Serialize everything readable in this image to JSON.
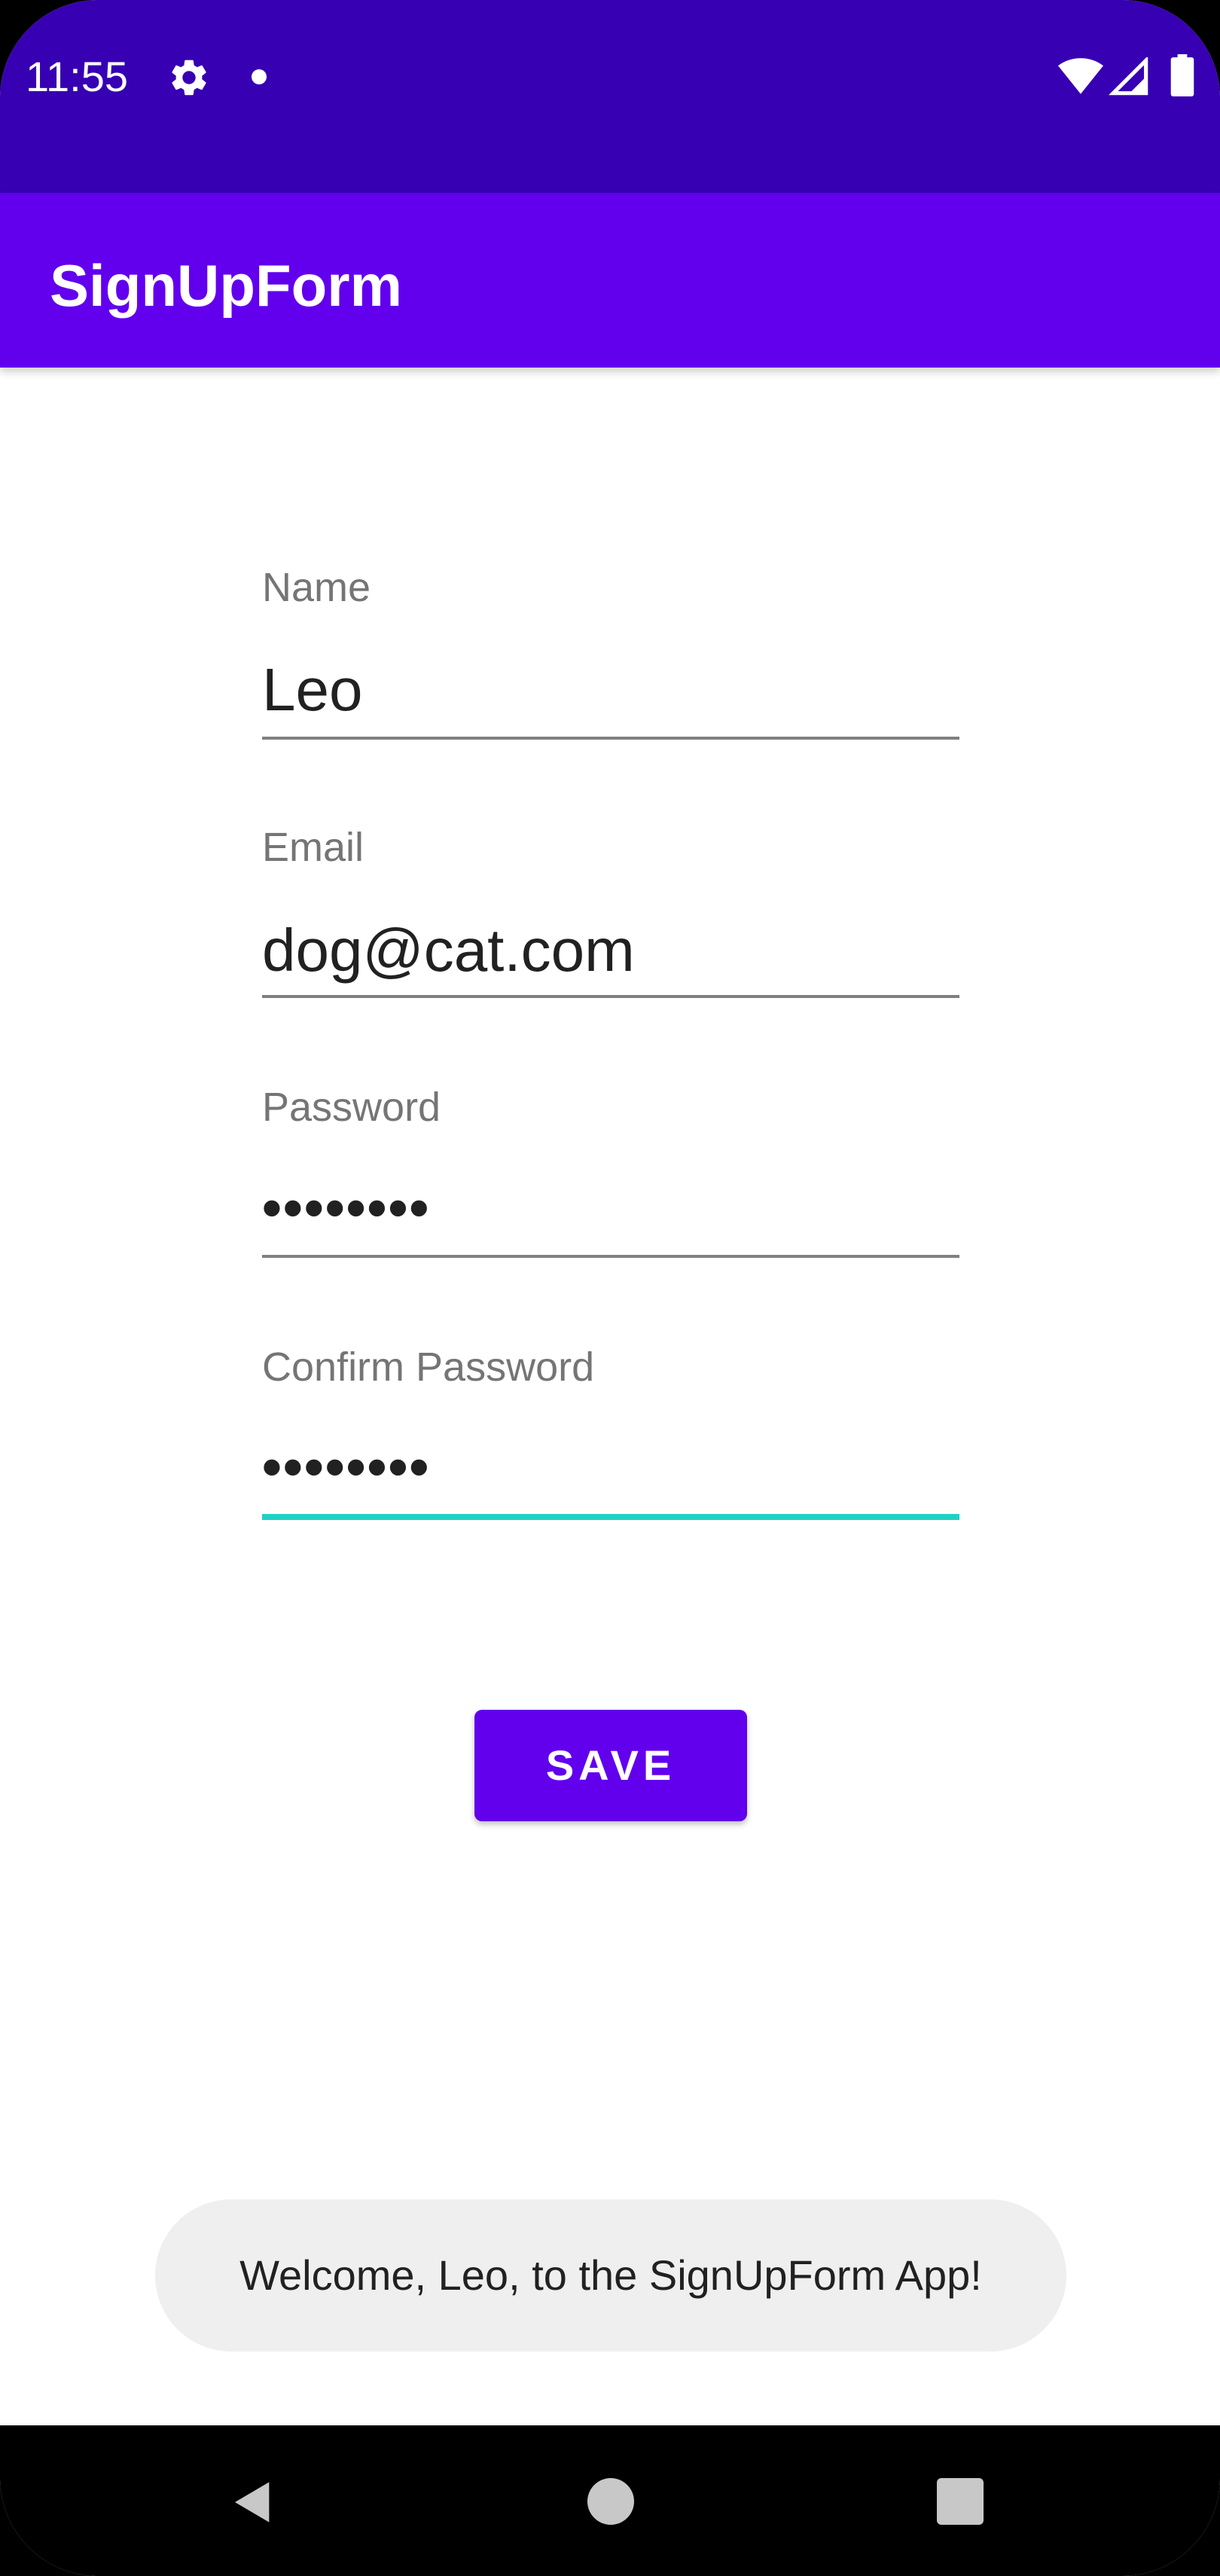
{
  "status_bar": {
    "time": "11:55",
    "icons": [
      "gear-icon",
      "notification-dot-icon",
      "wifi-icon",
      "cell-signal-icon",
      "battery-icon"
    ],
    "background": "#3700b3"
  },
  "app_bar": {
    "title": "SignUpForm",
    "background": "#6200ee"
  },
  "form": {
    "name": {
      "label": "Name",
      "value": "Leo"
    },
    "email": {
      "label": "Email",
      "value": "dog@cat.com"
    },
    "password": {
      "label": "Password",
      "value": "••••••••"
    },
    "confirm_password": {
      "label": "Confirm Password",
      "value": "••••••••",
      "focused": true,
      "focus_color": "#1ed2c3"
    }
  },
  "save_button": {
    "label": "SAVE",
    "background": "#6200ee"
  },
  "toast": {
    "message": "Welcome, Leo, to the SignUpForm App!"
  },
  "nav_bar": {
    "icons": [
      "back-icon",
      "home-icon",
      "recents-icon"
    ]
  }
}
